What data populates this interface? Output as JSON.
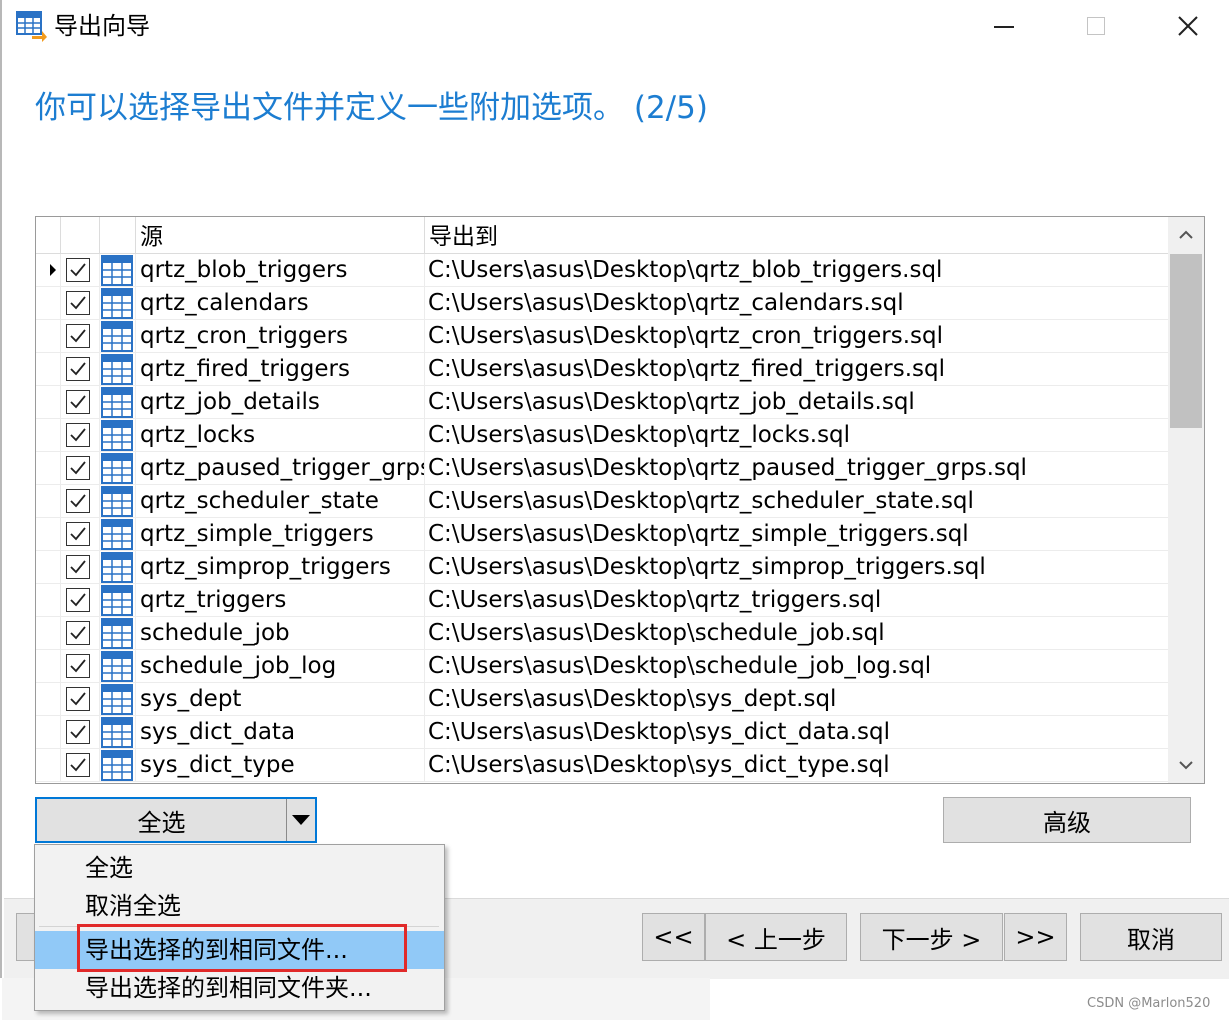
{
  "window": {
    "title": "导出向导"
  },
  "heading": "你可以选择导出文件并定义一些附加选项。 (2/5)",
  "grid": {
    "columns": {
      "source": "源",
      "export_to": "导出到"
    },
    "rows": [
      {
        "source": "qrtz_blob_triggers",
        "dest": "C:\\Users\\asus\\Desktop\\qrtz_blob_triggers.sql",
        "checked": true,
        "current": true
      },
      {
        "source": "qrtz_calendars",
        "dest": "C:\\Users\\asus\\Desktop\\qrtz_calendars.sql",
        "checked": true
      },
      {
        "source": "qrtz_cron_triggers",
        "dest": "C:\\Users\\asus\\Desktop\\qrtz_cron_triggers.sql",
        "checked": true
      },
      {
        "source": "qrtz_fired_triggers",
        "dest": "C:\\Users\\asus\\Desktop\\qrtz_fired_triggers.sql",
        "checked": true
      },
      {
        "source": "qrtz_job_details",
        "dest": "C:\\Users\\asus\\Desktop\\qrtz_job_details.sql",
        "checked": true
      },
      {
        "source": "qrtz_locks",
        "dest": "C:\\Users\\asus\\Desktop\\qrtz_locks.sql",
        "checked": true
      },
      {
        "source": "qrtz_paused_trigger_grps",
        "dest": "C:\\Users\\asus\\Desktop\\qrtz_paused_trigger_grps.sql",
        "checked": true
      },
      {
        "source": "qrtz_scheduler_state",
        "dest": "C:\\Users\\asus\\Desktop\\qrtz_scheduler_state.sql",
        "checked": true
      },
      {
        "source": "qrtz_simple_triggers",
        "dest": "C:\\Users\\asus\\Desktop\\qrtz_simple_triggers.sql",
        "checked": true
      },
      {
        "source": "qrtz_simprop_triggers",
        "dest": "C:\\Users\\asus\\Desktop\\qrtz_simprop_triggers.sql",
        "checked": true
      },
      {
        "source": "qrtz_triggers",
        "dest": "C:\\Users\\asus\\Desktop\\qrtz_triggers.sql",
        "checked": true
      },
      {
        "source": "schedule_job",
        "dest": "C:\\Users\\asus\\Desktop\\schedule_job.sql",
        "checked": true
      },
      {
        "source": "schedule_job_log",
        "dest": "C:\\Users\\asus\\Desktop\\schedule_job_log.sql",
        "checked": true
      },
      {
        "source": "sys_dept",
        "dest": "C:\\Users\\asus\\Desktop\\sys_dept.sql",
        "checked": true
      },
      {
        "source": "sys_dict_data",
        "dest": "C:\\Users\\asus\\Desktop\\sys_dict_data.sql",
        "checked": true
      },
      {
        "source": "sys_dict_type",
        "dest": "C:\\Users\\asus\\Desktop\\sys_dict_type.sql",
        "checked": true
      }
    ]
  },
  "buttons": {
    "select_all": "全选",
    "advanced": "高级",
    "first": "<<",
    "prev": "< 上一步",
    "next": "下一步 >",
    "last": ">>",
    "cancel": "取消"
  },
  "menu": {
    "items": [
      {
        "label": "全选",
        "highlighted": false
      },
      {
        "label": "取消全选",
        "highlighted": false
      },
      {
        "label": "导出选择的到相同文件...",
        "highlighted": true
      },
      {
        "label": "导出选择的到相同文件夹...",
        "highlighted": false
      }
    ]
  },
  "watermark": "CSDN @Marlon520",
  "colors": {
    "heading": "#1c7dd1",
    "menu_highlight": "#91c9f7",
    "annotation_box": "#e12a2a",
    "focus_border": "#0078d7"
  }
}
